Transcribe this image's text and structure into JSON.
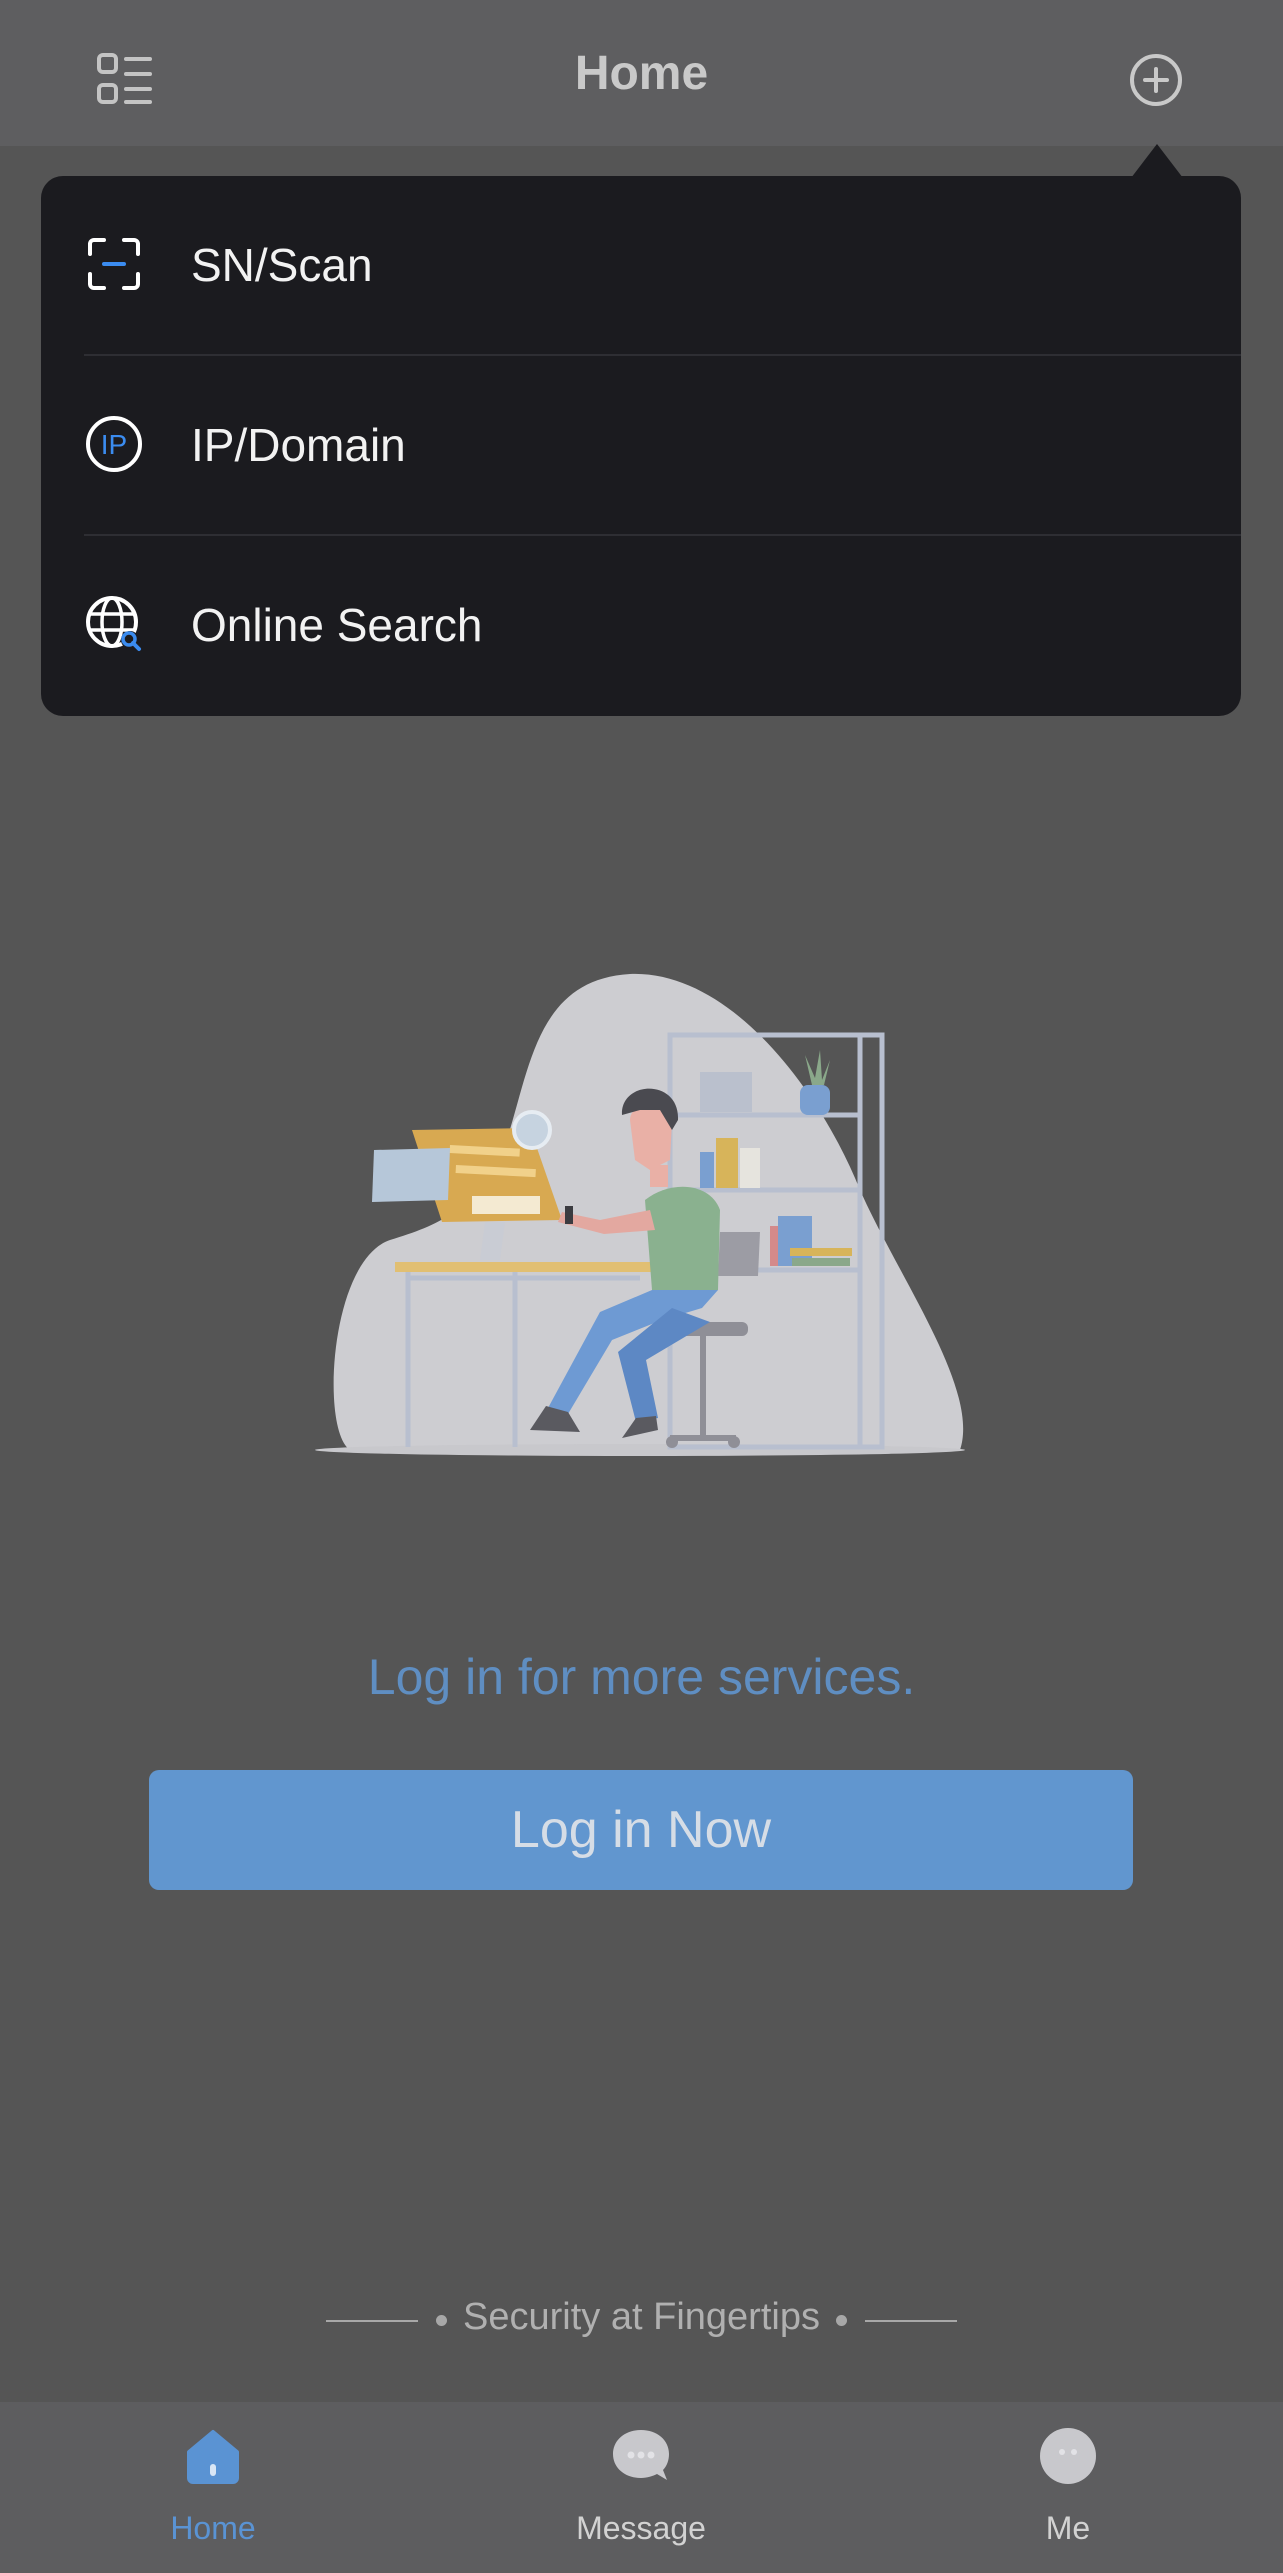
{
  "header": {
    "title": "Home"
  },
  "dropdown": {
    "items": [
      {
        "label": "SN/Scan",
        "icon": "scan-icon"
      },
      {
        "label": "IP/Domain",
        "icon": "ip-icon"
      },
      {
        "label": "Online Search",
        "icon": "globe-search-icon"
      }
    ]
  },
  "main": {
    "promo_text": "Log in for more services.",
    "login_button": "Log in Now",
    "slogan": "Security at Fingertips"
  },
  "tabbar": {
    "items": [
      {
        "label": "Home",
        "icon": "home-icon",
        "active": true
      },
      {
        "label": "Message",
        "icon": "message-icon",
        "active": false
      },
      {
        "label": "Me",
        "icon": "me-icon",
        "active": false
      }
    ]
  },
  "colors": {
    "accent": "#6196cf",
    "accent_text": "#5a93d3",
    "menu_bg": "#1b1b1f",
    "page_bg": "#555555"
  }
}
